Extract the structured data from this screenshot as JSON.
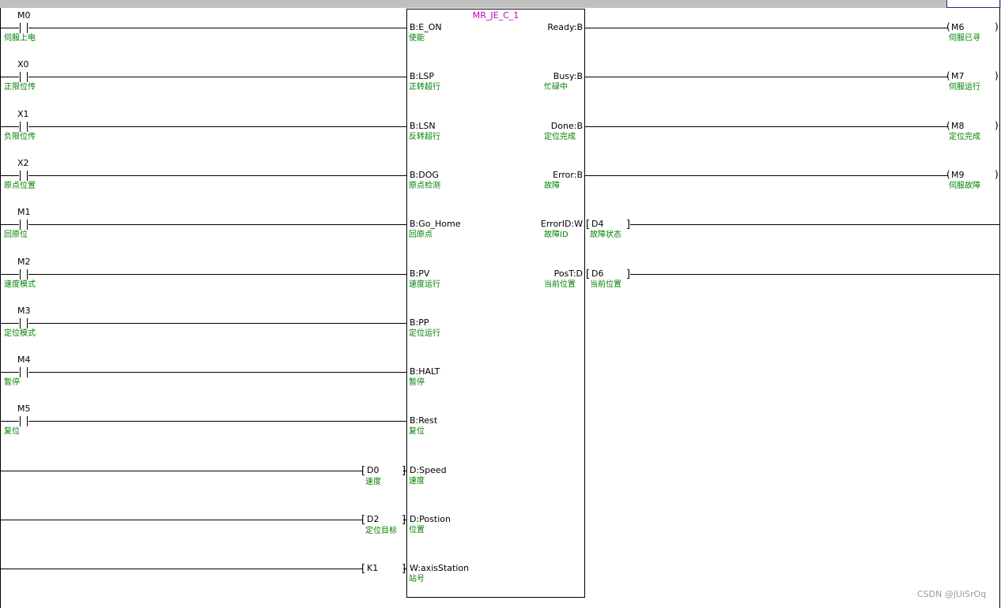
{
  "function_block": {
    "name": "MR_JE_C_1",
    "inputs": [
      {
        "pin": "B:E_ON",
        "comment": "使能"
      },
      {
        "pin": "B:LSP",
        "comment": "正转超行"
      },
      {
        "pin": "B:LSN",
        "comment": "反转超行"
      },
      {
        "pin": "B:DOG",
        "comment": "原点检测"
      },
      {
        "pin": "B:Go_Home",
        "comment": "回原点"
      },
      {
        "pin": "B:PV",
        "comment": "速度运行"
      },
      {
        "pin": "B:PP",
        "comment": "定位运行"
      },
      {
        "pin": "B:HALT",
        "comment": "暂停"
      },
      {
        "pin": "B:Rest",
        "comment": "复位"
      },
      {
        "pin": "D:Speed",
        "comment": "速度"
      },
      {
        "pin": "D:Postion",
        "comment": "位置"
      },
      {
        "pin": "W:axisStation",
        "comment": "站号"
      }
    ],
    "outputs": [
      {
        "pin": "Ready:B",
        "comment": ""
      },
      {
        "pin": "Busy:B",
        "comment": "忙碌中"
      },
      {
        "pin": "Done:B",
        "comment": "定位完成"
      },
      {
        "pin": "Error:B",
        "comment": "故障"
      },
      {
        "pin": "ErrorID:W",
        "comment": "故障ID"
      },
      {
        "pin": "PosT:D",
        "comment": "当前位置"
      }
    ]
  },
  "contacts": [
    {
      "device": "M0",
      "comment": "伺服上电"
    },
    {
      "device": "X0",
      "comment": "正限位传"
    },
    {
      "device": "X1",
      "comment": "负限位传"
    },
    {
      "device": "X2",
      "comment": "原点位置"
    },
    {
      "device": "M1",
      "comment": "回原位"
    },
    {
      "device": "M2",
      "comment": "速度模式"
    },
    {
      "device": "M3",
      "comment": "定位模式"
    },
    {
      "device": "M4",
      "comment": "暂停"
    },
    {
      "device": "M5",
      "comment": "复位"
    }
  ],
  "data_inputs": [
    {
      "device": "D0",
      "comment": "速度"
    },
    {
      "device": "D2",
      "comment": "定位目标"
    },
    {
      "device": "K1",
      "comment": ""
    }
  ],
  "coils": [
    {
      "device": "M6",
      "comment": "伺服已寻"
    },
    {
      "device": "M7",
      "comment": "伺服运行"
    },
    {
      "device": "M8",
      "comment": "定位完成"
    },
    {
      "device": "M9",
      "comment": "伺服故障"
    }
  ],
  "data_outputs": [
    {
      "device": "D4",
      "comment": "故障状态"
    },
    {
      "device": "D6",
      "comment": "当前位置"
    }
  ],
  "watermark": "CSDN @jUiSrOq"
}
